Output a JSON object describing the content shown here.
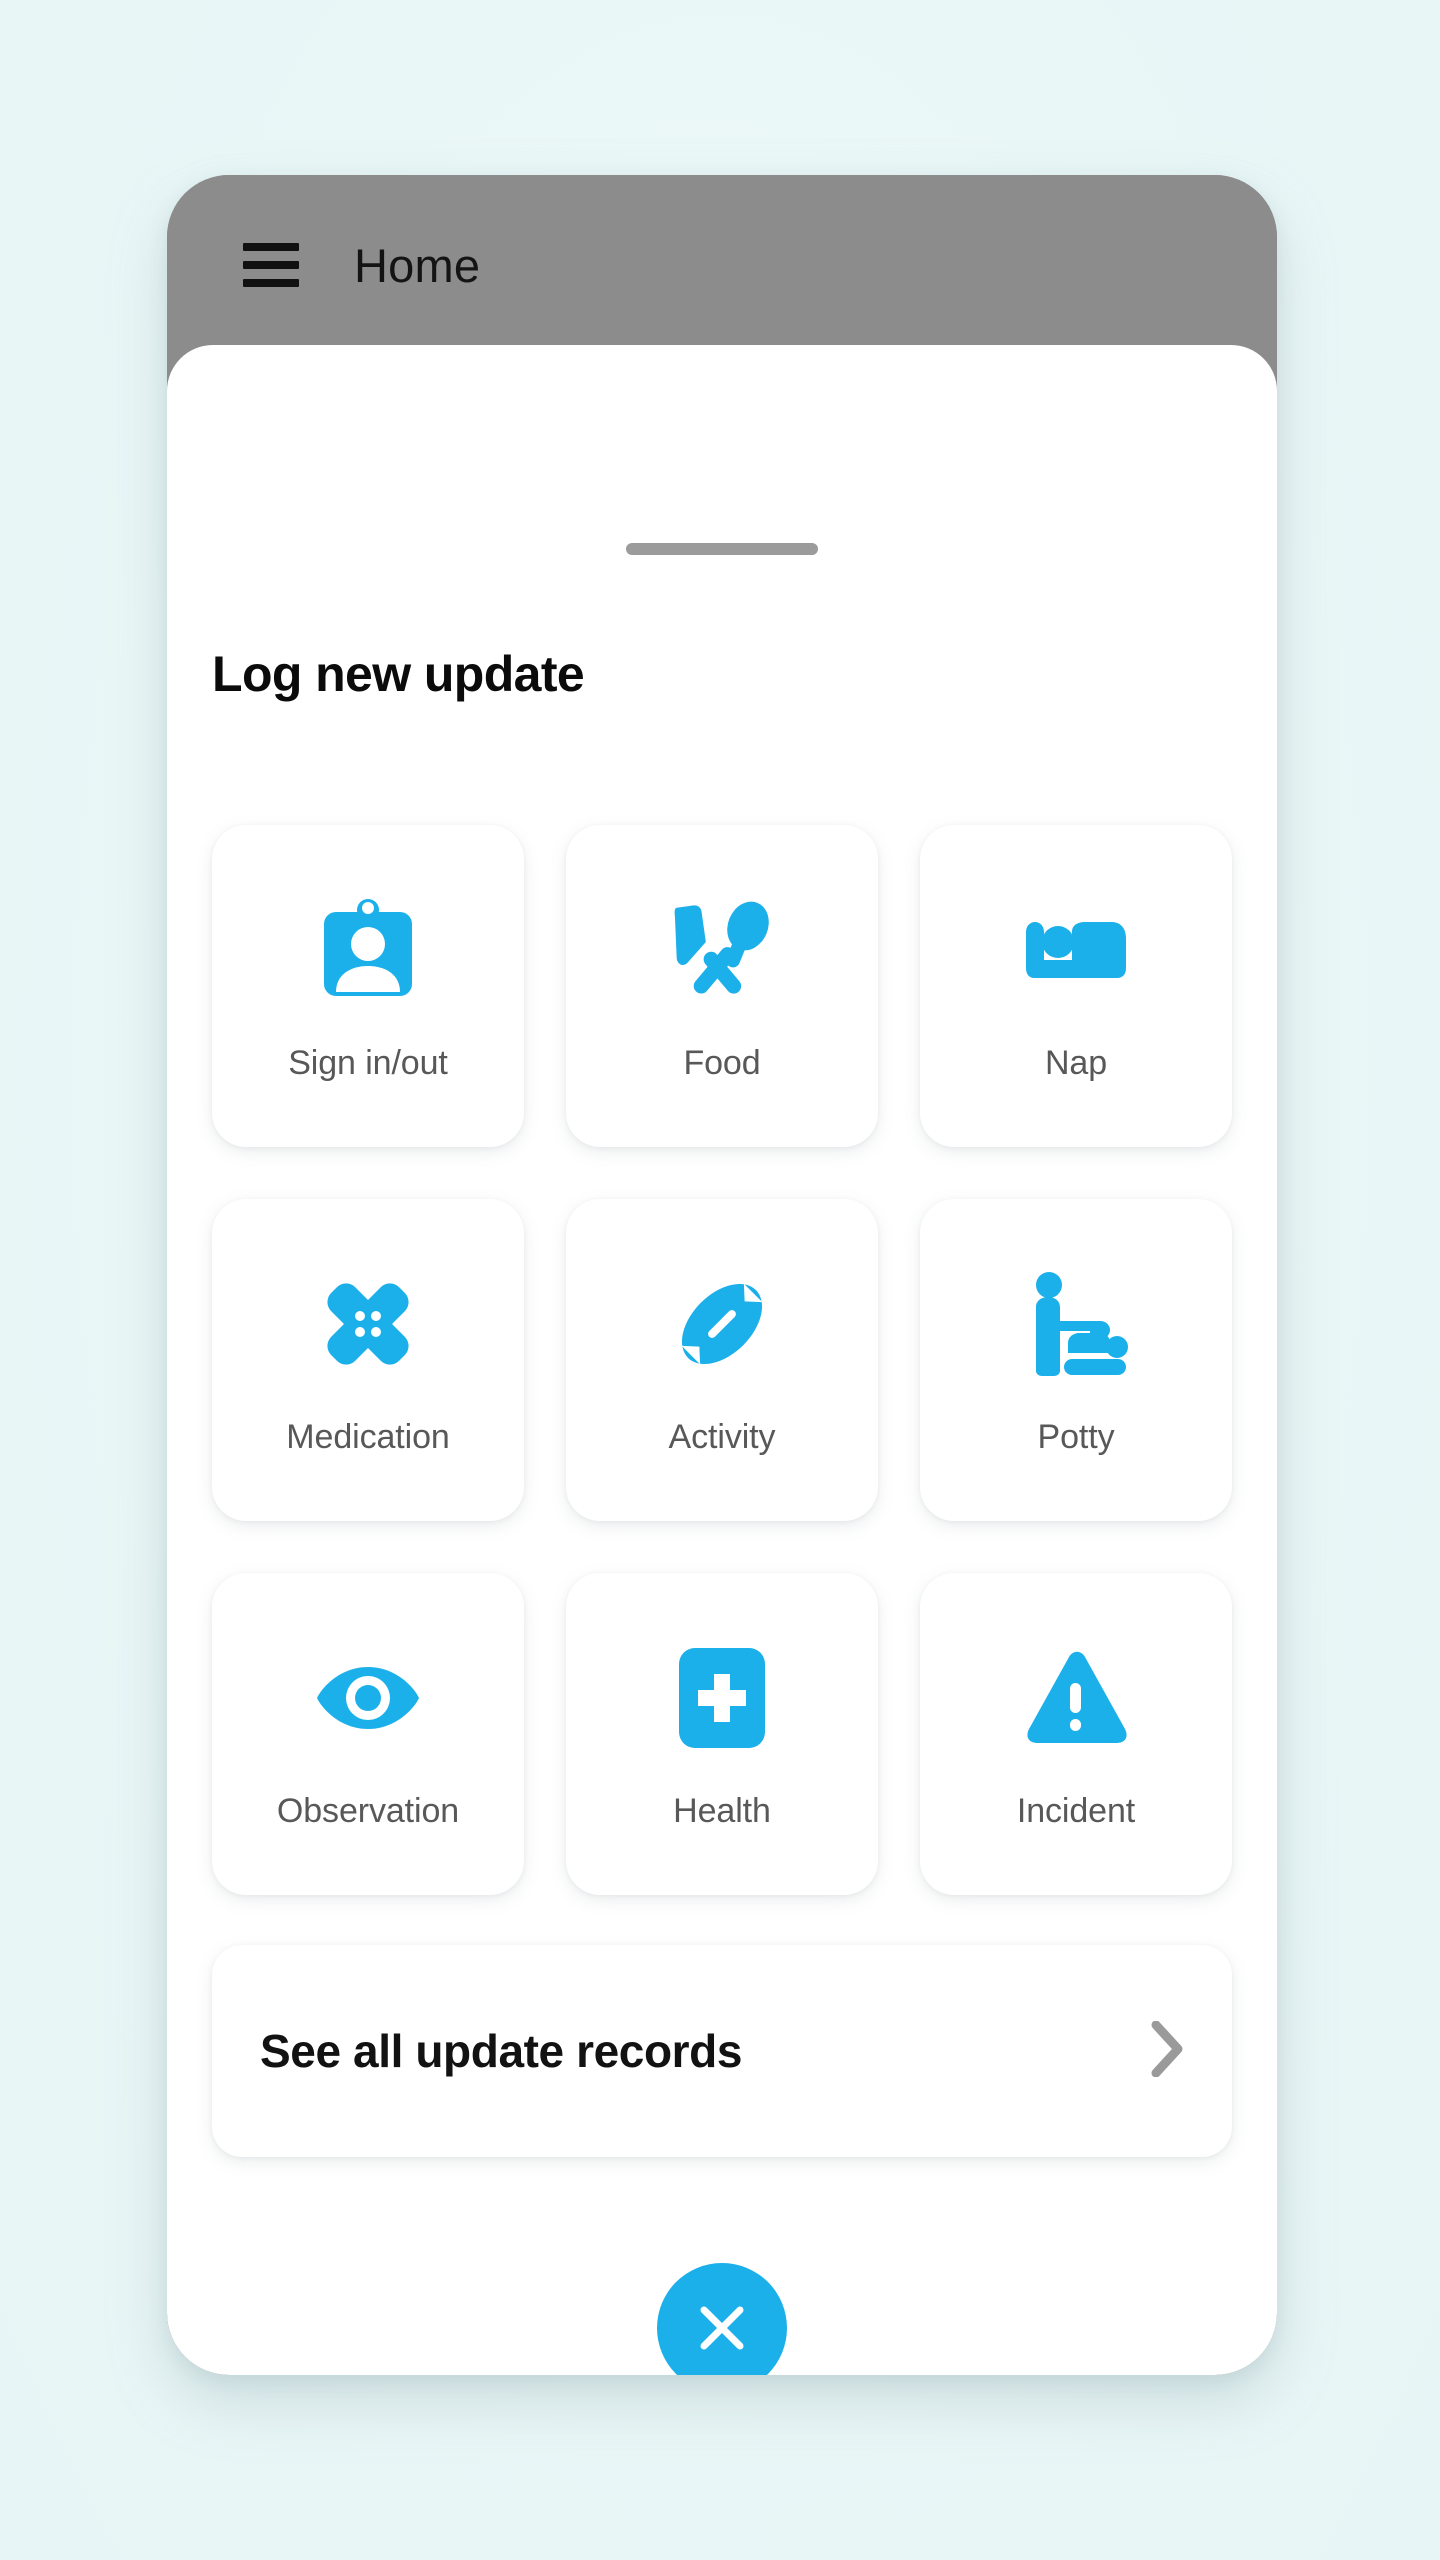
{
  "theme": {
    "background": "#edf8f8",
    "accent": "#1cb0ea",
    "appbar_bg": "#8c8c8c",
    "sheet_bg": "#ffffff",
    "label_color": "#585858"
  },
  "appbar": {
    "menu_icon": "hamburger-menu-icon",
    "title": "Home"
  },
  "sheet": {
    "handle": "drag-handle",
    "title": "Log new update"
  },
  "grid": {
    "tiles": [
      {
        "label": "Sign in/out",
        "icon": "id-badge-icon"
      },
      {
        "label": "Food",
        "icon": "cutlery-icon"
      },
      {
        "label": "Nap",
        "icon": "bed-sleep-icon"
      },
      {
        "label": "Medication",
        "icon": "bandage-cross-icon"
      },
      {
        "label": "Activity",
        "icon": "football-icon"
      },
      {
        "label": "Potty",
        "icon": "baby-changing-icon"
      },
      {
        "label": "Observation",
        "icon": "eye-icon"
      },
      {
        "label": "Health",
        "icon": "medical-cross-icon"
      },
      {
        "label": "Incident",
        "icon": "warning-triangle-icon"
      }
    ]
  },
  "records": {
    "label": "See all update records",
    "chevron_icon": "chevron-right-icon"
  },
  "close_button": {
    "icon": "close-x-icon",
    "label": "Close"
  }
}
